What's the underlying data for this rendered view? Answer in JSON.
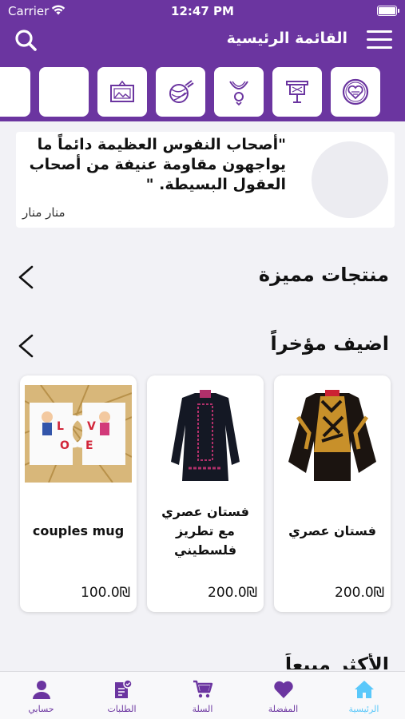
{
  "status_bar": {
    "carrier": "Carrier",
    "time": "12:47 PM"
  },
  "nav": {
    "title": "القائمة الرئيسية"
  },
  "categories": [
    {
      "icon": "embroidery-hoop-heart-icon"
    },
    {
      "icon": "tapestry-frame-icon"
    },
    {
      "icon": "necklace-icon"
    },
    {
      "icon": "yarn-ball-icon"
    },
    {
      "icon": "picture-frame-icon"
    },
    {
      "icon": "blank-category-icon"
    }
  ],
  "quote": {
    "text": "\"أصحاب النفوس العظيمة دائماً ما يواجهون مقاومة عنيفة من أصحاب العقول البسيطة. \"",
    "author": "منار منار"
  },
  "sections": {
    "featured": "منتجات مميزة",
    "recent": "اضيف مؤخراً"
  },
  "products": [
    {
      "name": "فستان عصري",
      "price": "200.0₪",
      "image": "patterned-dress-photo"
    },
    {
      "name": "فستان عصري مع تطريز فلسطيني",
      "price": "200.0₪",
      "image": "embroidered-dress-photo"
    },
    {
      "name": "couples mug",
      "price": "100.0₪",
      "image": "couples-mugs-photo"
    }
  ],
  "cut_section": "الأكثر مبيعاً",
  "tabs": [
    {
      "label": "الرئيسية",
      "icon": "home-icon",
      "active": true
    },
    {
      "label": "المفضلة",
      "icon": "heart-icon"
    },
    {
      "label": "السلة",
      "icon": "cart-icon"
    },
    {
      "label": "الطلبات",
      "icon": "orders-icon"
    },
    {
      "label": "حسابي",
      "icon": "profile-icon"
    }
  ],
  "colors": {
    "primary": "#6b35a0",
    "active_tab": "#5ac8fa",
    "background": "#f2f2f6"
  }
}
